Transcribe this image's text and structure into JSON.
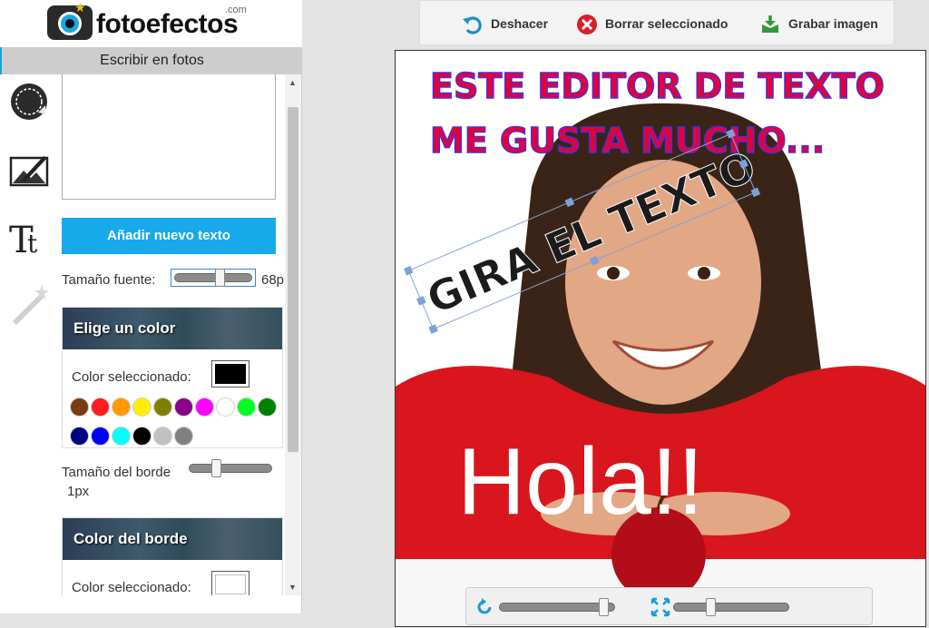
{
  "logo": {
    "name": "fotoefectos",
    "tld": ".com"
  },
  "panel": {
    "title": "Escribir en fotos"
  },
  "text_editor": {
    "value": "",
    "add_button": "Añadir nuevo texto"
  },
  "font_size": {
    "label": "Tamaño fuente:",
    "value": "68p",
    "level_percent": 60
  },
  "color_panel": {
    "title": "Elige un color",
    "selected_label": "Color seleccionado:",
    "selected_color": "#000000",
    "palette": [
      "#7a3a12",
      "#ff1d1d",
      "#ff9900",
      "#ffee00",
      "#808000",
      "#8b008b",
      "#ff00ff",
      "#ffffff",
      "#00ff22",
      "#008000",
      "#000080",
      "#0000ff",
      "#00ffff",
      "#000000",
      "#c0c0c0",
      "#808080"
    ]
  },
  "border_size": {
    "label": "Tamaño del borde",
    "value": "1px",
    "level_percent": 30
  },
  "border_color_panel": {
    "title": "Color del borde",
    "selected_label": "Color seleccionado:",
    "selected_color": "#ffffff"
  },
  "actions": {
    "undo": "Deshacer",
    "delete": "Borrar seleccionado",
    "save": "Grabar imagen"
  },
  "canvas": {
    "line1": "ESTE EDITOR DE TEXTO",
    "line2": "ME GUSTA MUCHO...",
    "rotated": "GIRA EL TEXTO",
    "hello": "Hola!!"
  },
  "bottom": {
    "rotate_level_percent": 95,
    "scale_level_percent": 30
  },
  "colors": {
    "accent": "#17a9ea",
    "title_red": "#e4003b",
    "title_outline": "#4b2fd6"
  }
}
